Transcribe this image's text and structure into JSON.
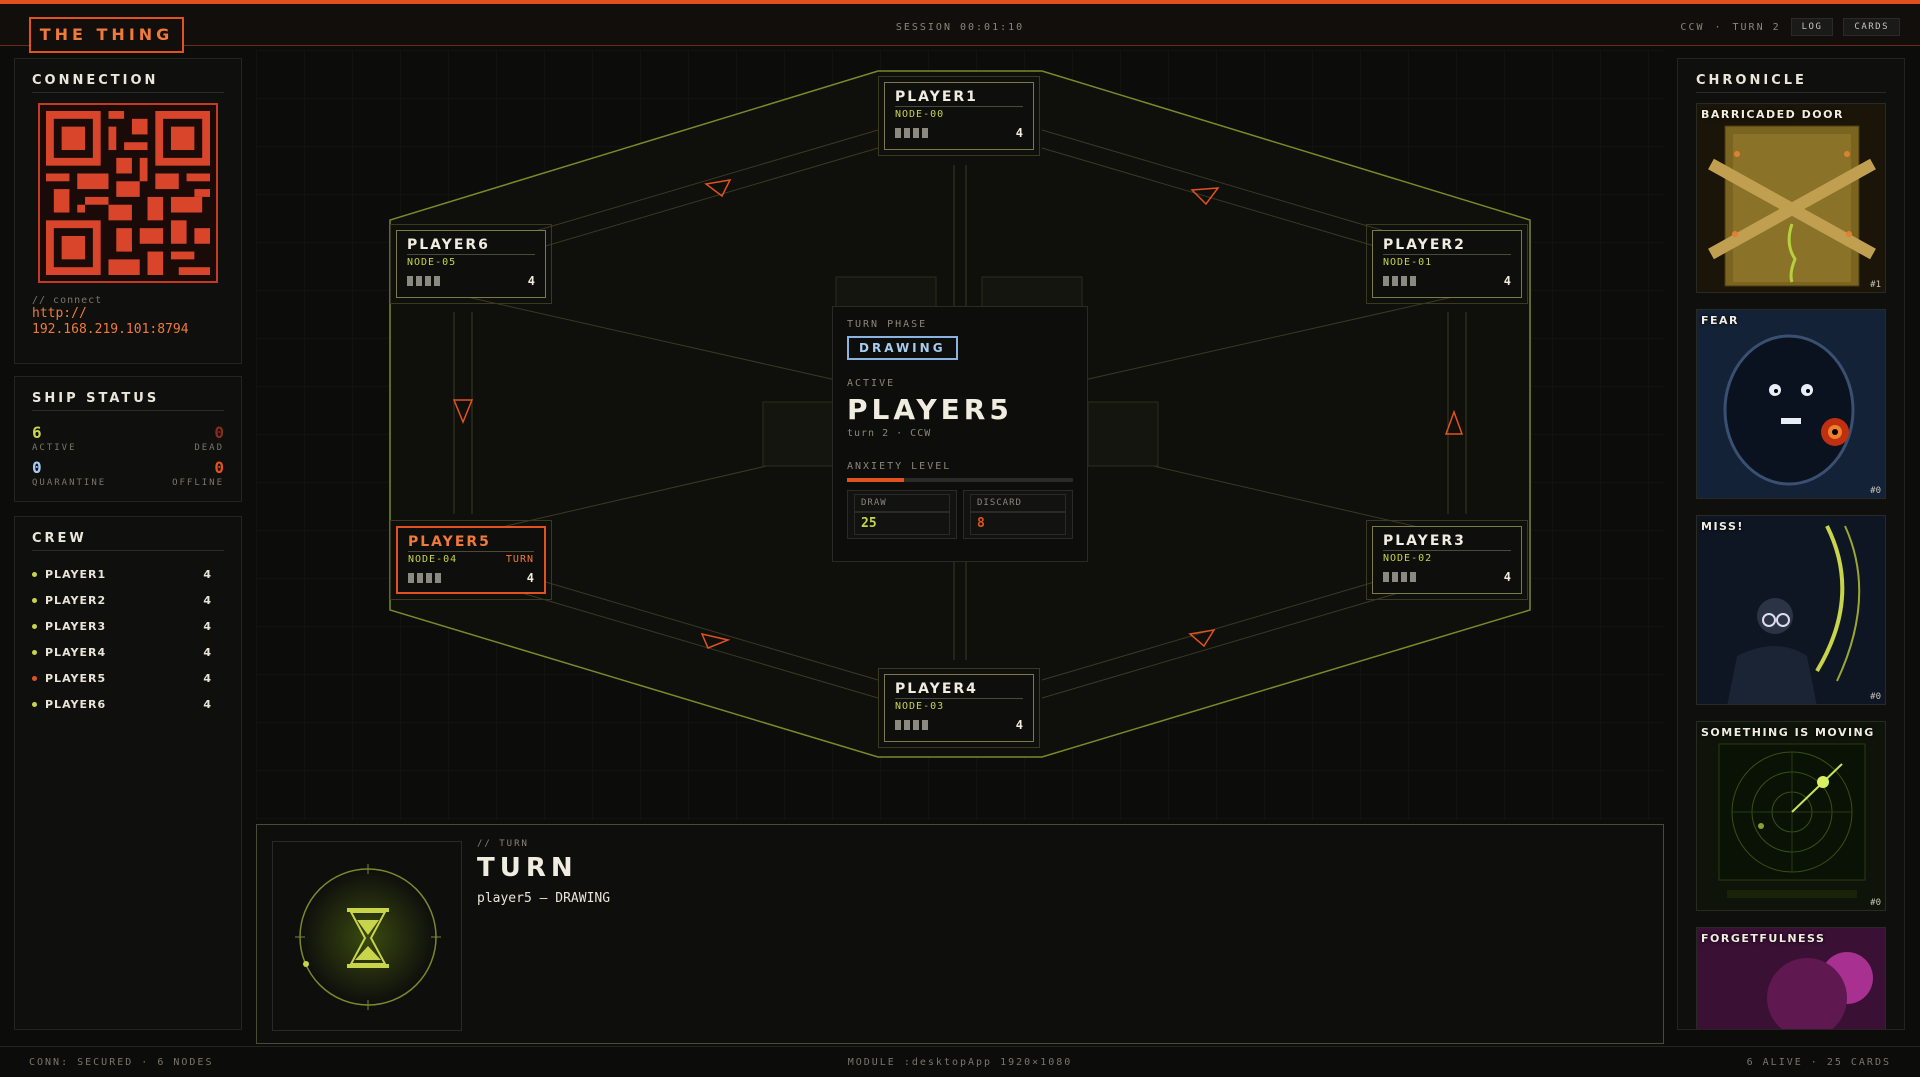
{
  "app": {
    "title": "THE THING"
  },
  "topbar": {
    "session": "SESSION  00:01:10",
    "direction": "CCW",
    "sep": "·",
    "turn": "TURN 2",
    "log_label": "LOG",
    "cards_label": "CARDS"
  },
  "connection": {
    "title": "CONNECTION",
    "hint": "// connect",
    "url_line1": "http://",
    "url_line2": "192.168.219.101:8794"
  },
  "ship_status": {
    "title": "SHIP STATUS",
    "active_value": "6",
    "active_label": "ACTIVE",
    "dead_value": "0",
    "dead_label": "DEAD",
    "quarantine_value": "0",
    "quarantine_label": "QUARANTINE",
    "offline_value": "0",
    "offline_label": "OFFLINE"
  },
  "crew": {
    "title": "CREW",
    "members": [
      {
        "name": "PLAYER1",
        "count": "4",
        "color": "#c8d44a"
      },
      {
        "name": "PLAYER2",
        "count": "4",
        "color": "#c8d44a"
      },
      {
        "name": "PLAYER3",
        "count": "4",
        "color": "#c8d44a"
      },
      {
        "name": "PLAYER4",
        "count": "4",
        "color": "#c8d44a"
      },
      {
        "name": "PLAYER5",
        "count": "4",
        "color": "#e2521f"
      },
      {
        "name": "PLAYER6",
        "count": "4",
        "color": "#c8d44a"
      }
    ]
  },
  "nodes": [
    {
      "name": "PLAYER1",
      "node": "NODE-00",
      "count": "4",
      "tag": ""
    },
    {
      "name": "PLAYER2",
      "node": "NODE-01",
      "count": "4",
      "tag": ""
    },
    {
      "name": "PLAYER3",
      "node": "NODE-02",
      "count": "4",
      "tag": ""
    },
    {
      "name": "PLAYER4",
      "node": "NODE-03",
      "count": "4",
      "tag": ""
    },
    {
      "name": "PLAYER5",
      "node": "NODE-04",
      "count": "4",
      "tag": "TURN"
    },
    {
      "name": "PLAYER6",
      "node": "NODE-05",
      "count": "4",
      "tag": ""
    }
  ],
  "center": {
    "phase_label": "TURN PHASE",
    "phase": "DRAWING",
    "active_label": "ACTIVE",
    "active_player": "PLAYER5",
    "sub": "turn 2  ·  CCW",
    "anxiety_label": "ANXIETY LEVEL",
    "anxiety": 0.25,
    "draw_label": "DRAW",
    "draw_value": "25",
    "discard_label": "DISCARD",
    "discard_value": "8"
  },
  "turn_panel": {
    "hint": "// TURN",
    "title": "TURN",
    "sub": "player5 — DRAWING"
  },
  "chronicle": {
    "title": "CHRONICLE",
    "cards": [
      {
        "title": "BARRICADED DOOR",
        "num": "#1",
        "icon": "barricaded-door"
      },
      {
        "title": "FEAR",
        "num": "#0",
        "icon": "fear-face"
      },
      {
        "title": "MISS!",
        "num": "#0",
        "icon": "miss-figure"
      },
      {
        "title": "SOMETHING IS MOVING",
        "num": "#0",
        "icon": "radar"
      },
      {
        "title": "FORGETFULNESS",
        "num": "",
        "icon": "forgetfulness"
      }
    ]
  },
  "footer": {
    "left": "CONN: SECURED · 6 NODES",
    "center": "MODULE :desktopApp  1920×1080",
    "right": "6 ALIVE · 25 CARDS"
  },
  "colors": {
    "accent": "#e2521f",
    "lime": "#c8d44a",
    "blue": "#8ab4e0"
  }
}
